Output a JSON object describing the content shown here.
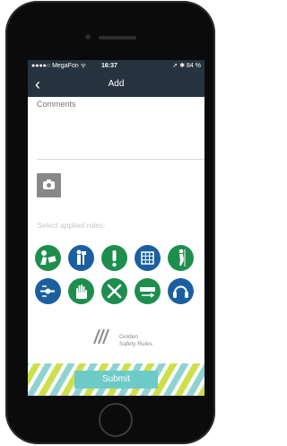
{
  "status": {
    "carrier": "●●●●○ MegaFon ᯤ",
    "time": "16:37",
    "battery": "➚ ✱ 84 %"
  },
  "nav": {
    "back": "‹",
    "title": "Add"
  },
  "form": {
    "comments_placeholder": "Comments",
    "rules_label": "Select applied rules:"
  },
  "rules": [
    {
      "icon": "person-reading-icon",
      "color": "#1e8e4d"
    },
    {
      "icon": "person-with-sign-icon",
      "color": "#1c5f9e"
    },
    {
      "icon": "exclamation-icon",
      "color": "#1e8e4d"
    },
    {
      "icon": "grid-permit-icon",
      "color": "#1c5f9e"
    },
    {
      "icon": "climbing-harness-icon",
      "color": "#1e8e4d"
    },
    {
      "icon": "isolation-valve-icon",
      "color": "#1c5f9e"
    },
    {
      "icon": "glove-hand-icon",
      "color": "#1e8e4d"
    },
    {
      "icon": "wrench-tools-icon",
      "color": "#1e8e4d"
    },
    {
      "icon": "bypass-arrows-icon",
      "color": "#1e8e4d"
    },
    {
      "icon": "ear-protection-icon",
      "color": "#1c5f9e"
    }
  ],
  "logo": {
    "line1": "Golden",
    "line2": "Safety Rules"
  },
  "footer": {
    "submit": "Submit"
  }
}
